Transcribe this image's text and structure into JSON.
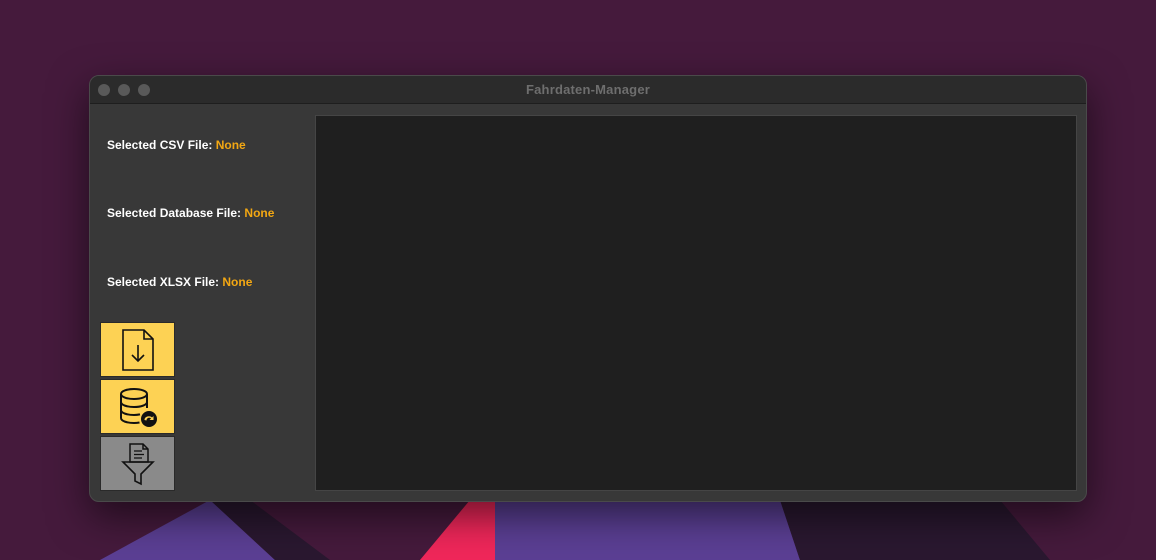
{
  "window": {
    "title": "Fahrdaten-Manager"
  },
  "file_status": {
    "csv": {
      "label": "Selected CSV File:",
      "value": "None"
    },
    "database": {
      "label": "Selected Database File:",
      "value": "None"
    },
    "xlsx": {
      "label": "Selected XLSX File:",
      "value": "None"
    }
  },
  "toolbar": {
    "buttons": [
      {
        "icon": "file-download-icon",
        "color": "#fdd254",
        "enabled": true
      },
      {
        "icon": "database-sync-icon",
        "color": "#fdd254",
        "enabled": true
      },
      {
        "icon": "document-filter-icon",
        "color": "#8a8a8a",
        "enabled": false
      }
    ]
  },
  "colors": {
    "accent": "#f2a713",
    "button_yellow": "#fdd254",
    "button_disabled": "#8a8a8a",
    "desktop": "#451a3c"
  }
}
